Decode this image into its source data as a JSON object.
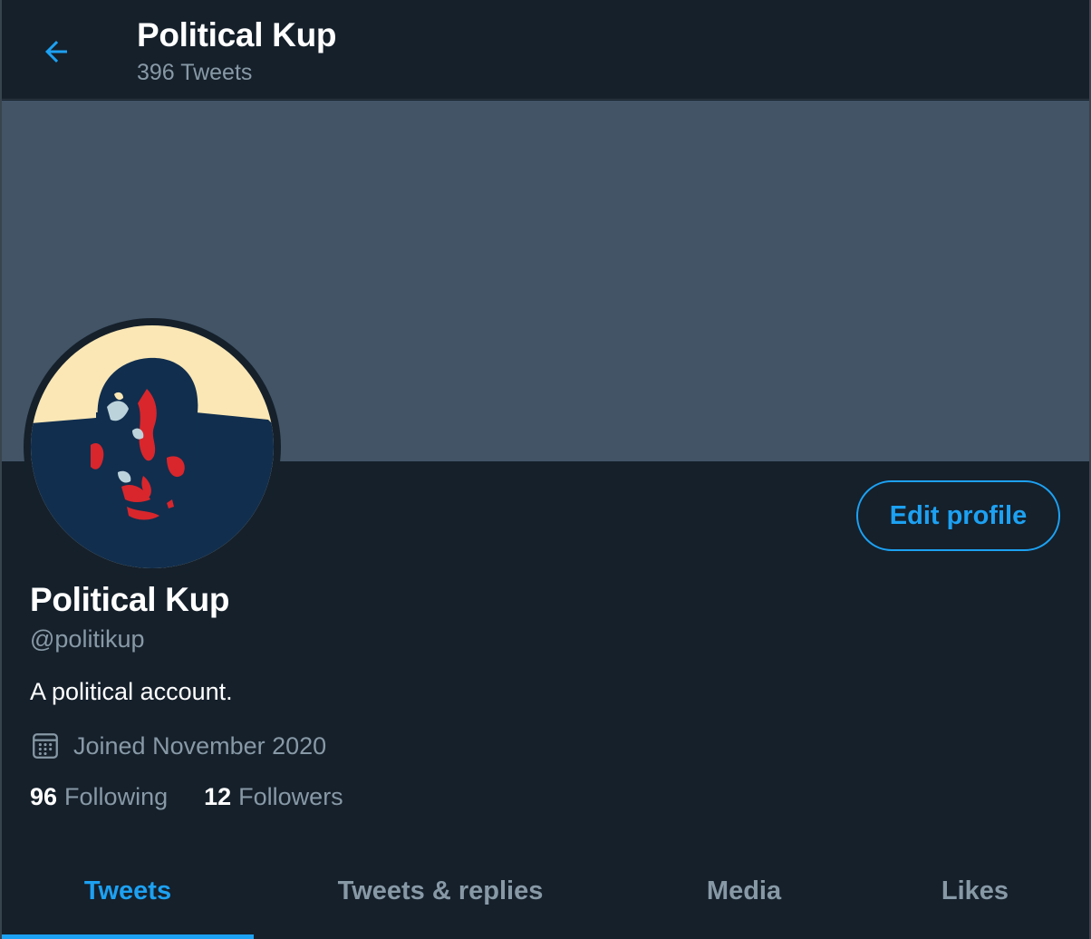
{
  "header": {
    "title": "Political Kup",
    "tweet_count": "396 Tweets"
  },
  "profile": {
    "name": "Political Kup",
    "handle": "@politikup",
    "bio": "A political account.",
    "joined": "Joined November 2020",
    "following_count": "96",
    "following_label": "Following",
    "followers_count": "12",
    "followers_label": "Followers",
    "edit_button": "Edit profile"
  },
  "tabs": [
    {
      "label": "Tweets",
      "active": true
    },
    {
      "label": "Tweets & replies",
      "active": false
    },
    {
      "label": "Media",
      "active": false
    },
    {
      "label": "Likes",
      "active": false
    }
  ],
  "colors": {
    "background": "#15202b",
    "banner": "#425466",
    "accent": "#1da1f2",
    "muted_text": "#8899a6",
    "avatar_cream": "#fae7b5",
    "avatar_navy": "#112e4e",
    "avatar_red": "#d8262c"
  },
  "icons": {
    "back": "arrow-left-icon",
    "joined": "calendar-icon"
  }
}
